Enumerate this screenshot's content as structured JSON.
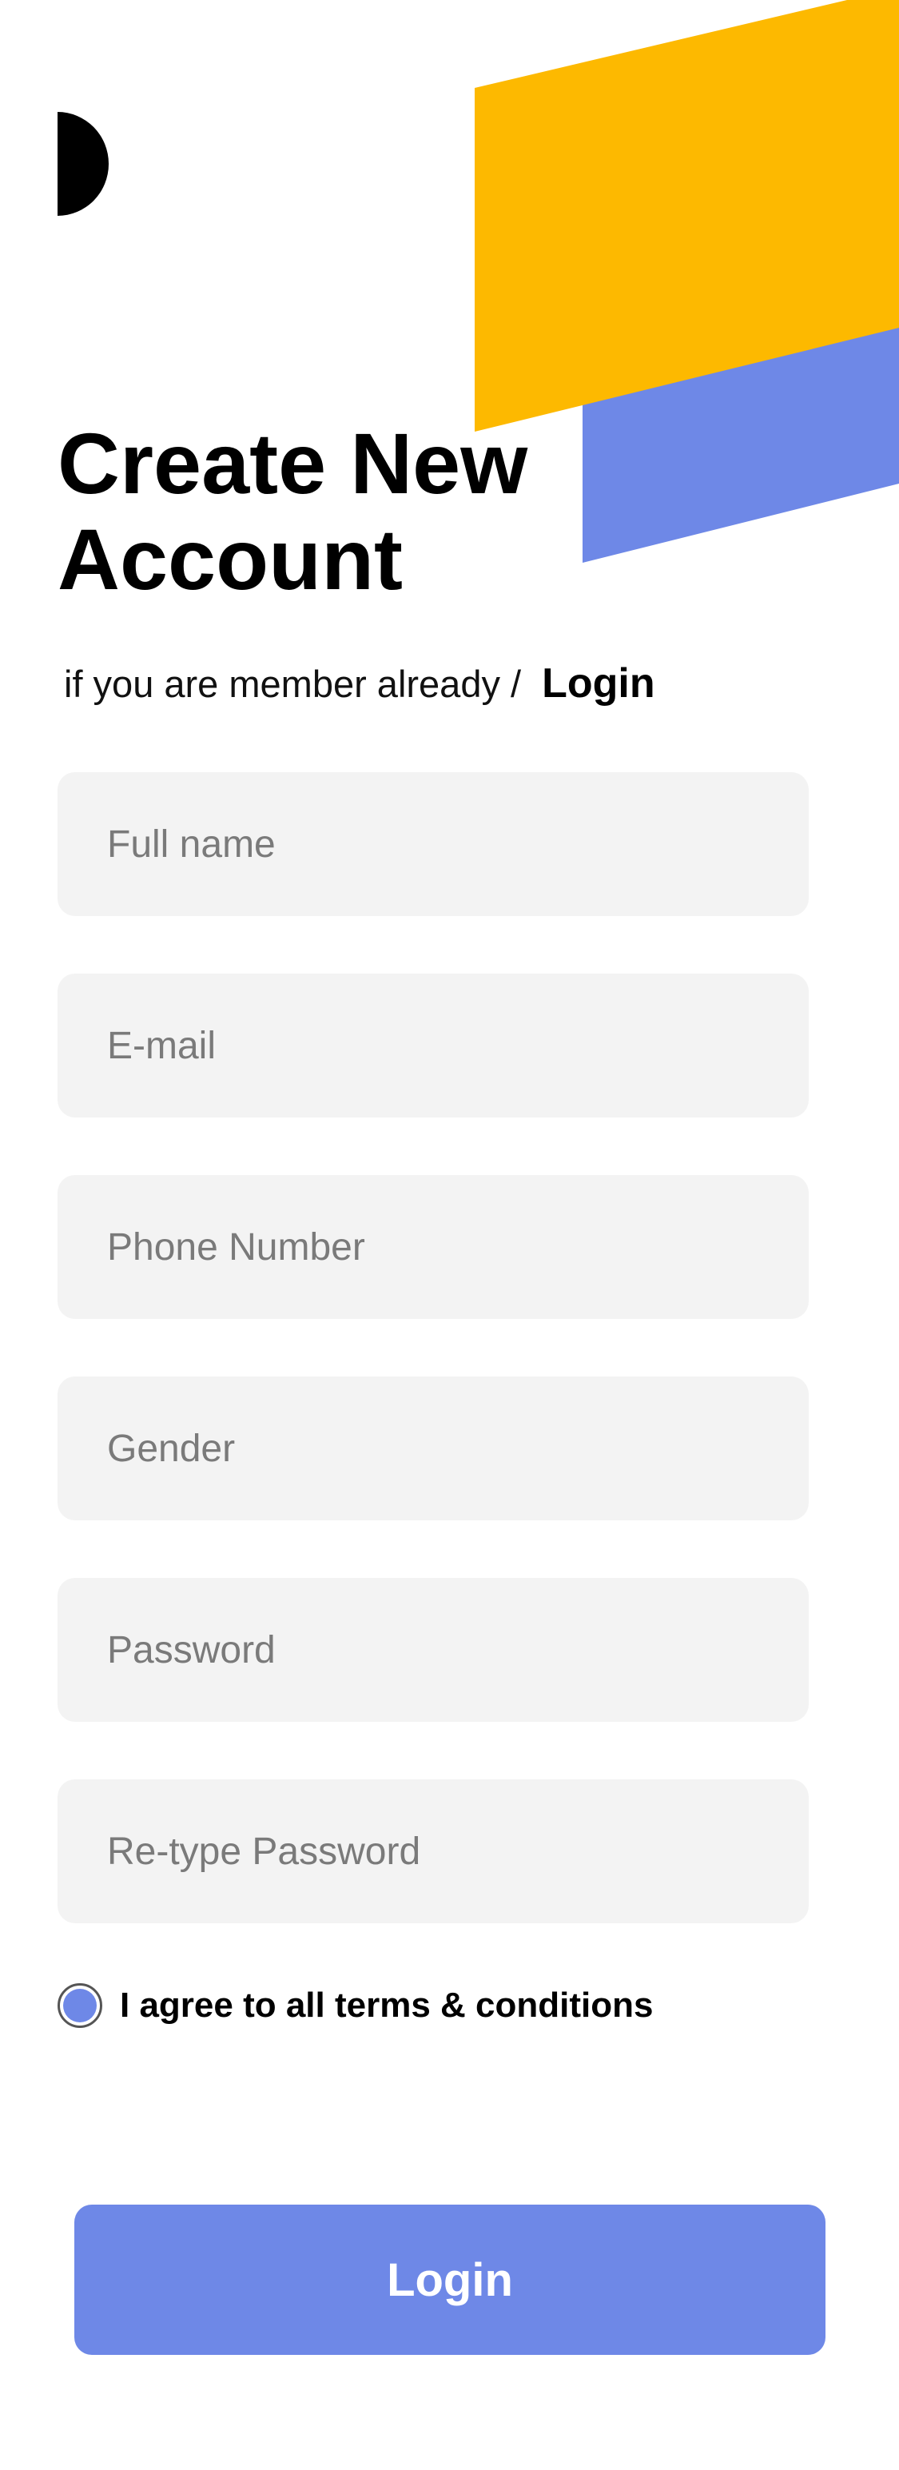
{
  "colors": {
    "accent_yellow": "#FDB900",
    "accent_blue": "#6E88E7",
    "input_background": "#F3F3F3",
    "text_primary": "#000000",
    "placeholder": "#7A7A7A"
  },
  "icons": {
    "logo": "half-circle-logo-icon"
  },
  "header": {
    "title_line1": "Create New",
    "title_line2": "Account"
  },
  "member_prompt": {
    "text": "if you are member already /",
    "login_link": "Login"
  },
  "form": {
    "fields": [
      {
        "placeholder": "Full name",
        "value": ""
      },
      {
        "placeholder": "E-mail",
        "value": ""
      },
      {
        "placeholder": "Phone Number",
        "value": ""
      },
      {
        "placeholder": "Gender",
        "value": ""
      },
      {
        "placeholder": "Password",
        "value": ""
      },
      {
        "placeholder": "Re-type Password",
        "value": ""
      }
    ],
    "terms_label": "I agree to all terms & conditions",
    "terms_checked": true,
    "submit_label": "Login"
  }
}
